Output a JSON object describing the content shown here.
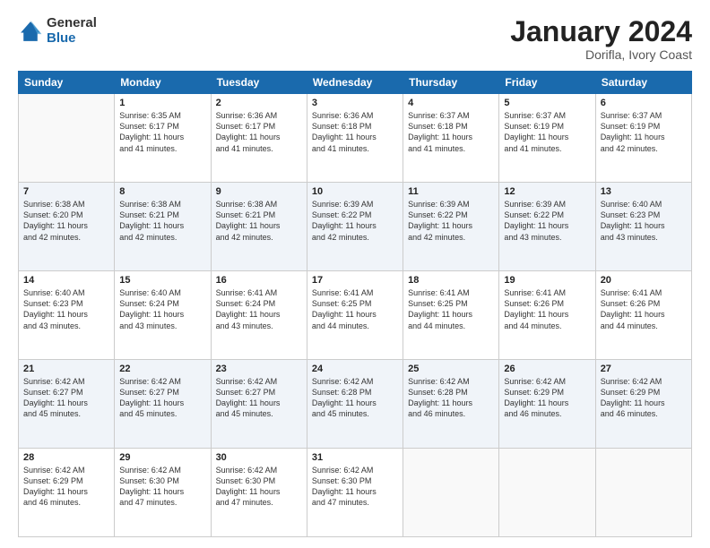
{
  "header": {
    "logo_general": "General",
    "logo_blue": "Blue",
    "main_title": "January 2024",
    "subtitle": "Dorifla, Ivory Coast"
  },
  "days_of_week": [
    "Sunday",
    "Monday",
    "Tuesday",
    "Wednesday",
    "Thursday",
    "Friday",
    "Saturday"
  ],
  "weeks": [
    [
      {
        "day": "",
        "info": ""
      },
      {
        "day": "1",
        "info": "Sunrise: 6:35 AM\nSunset: 6:17 PM\nDaylight: 11 hours\nand 41 minutes."
      },
      {
        "day": "2",
        "info": "Sunrise: 6:36 AM\nSunset: 6:17 PM\nDaylight: 11 hours\nand 41 minutes."
      },
      {
        "day": "3",
        "info": "Sunrise: 6:36 AM\nSunset: 6:18 PM\nDaylight: 11 hours\nand 41 minutes."
      },
      {
        "day": "4",
        "info": "Sunrise: 6:37 AM\nSunset: 6:18 PM\nDaylight: 11 hours\nand 41 minutes."
      },
      {
        "day": "5",
        "info": "Sunrise: 6:37 AM\nSunset: 6:19 PM\nDaylight: 11 hours\nand 41 minutes."
      },
      {
        "day": "6",
        "info": "Sunrise: 6:37 AM\nSunset: 6:19 PM\nDaylight: 11 hours\nand 42 minutes."
      }
    ],
    [
      {
        "day": "7",
        "info": "Sunrise: 6:38 AM\nSunset: 6:20 PM\nDaylight: 11 hours\nand 42 minutes."
      },
      {
        "day": "8",
        "info": "Sunrise: 6:38 AM\nSunset: 6:21 PM\nDaylight: 11 hours\nand 42 minutes."
      },
      {
        "day": "9",
        "info": "Sunrise: 6:38 AM\nSunset: 6:21 PM\nDaylight: 11 hours\nand 42 minutes."
      },
      {
        "day": "10",
        "info": "Sunrise: 6:39 AM\nSunset: 6:22 PM\nDaylight: 11 hours\nand 42 minutes."
      },
      {
        "day": "11",
        "info": "Sunrise: 6:39 AM\nSunset: 6:22 PM\nDaylight: 11 hours\nand 42 minutes."
      },
      {
        "day": "12",
        "info": "Sunrise: 6:39 AM\nSunset: 6:22 PM\nDaylight: 11 hours\nand 43 minutes."
      },
      {
        "day": "13",
        "info": "Sunrise: 6:40 AM\nSunset: 6:23 PM\nDaylight: 11 hours\nand 43 minutes."
      }
    ],
    [
      {
        "day": "14",
        "info": "Sunrise: 6:40 AM\nSunset: 6:23 PM\nDaylight: 11 hours\nand 43 minutes."
      },
      {
        "day": "15",
        "info": "Sunrise: 6:40 AM\nSunset: 6:24 PM\nDaylight: 11 hours\nand 43 minutes."
      },
      {
        "day": "16",
        "info": "Sunrise: 6:41 AM\nSunset: 6:24 PM\nDaylight: 11 hours\nand 43 minutes."
      },
      {
        "day": "17",
        "info": "Sunrise: 6:41 AM\nSunset: 6:25 PM\nDaylight: 11 hours\nand 44 minutes."
      },
      {
        "day": "18",
        "info": "Sunrise: 6:41 AM\nSunset: 6:25 PM\nDaylight: 11 hours\nand 44 minutes."
      },
      {
        "day": "19",
        "info": "Sunrise: 6:41 AM\nSunset: 6:26 PM\nDaylight: 11 hours\nand 44 minutes."
      },
      {
        "day": "20",
        "info": "Sunrise: 6:41 AM\nSunset: 6:26 PM\nDaylight: 11 hours\nand 44 minutes."
      }
    ],
    [
      {
        "day": "21",
        "info": "Sunrise: 6:42 AM\nSunset: 6:27 PM\nDaylight: 11 hours\nand 45 minutes."
      },
      {
        "day": "22",
        "info": "Sunrise: 6:42 AM\nSunset: 6:27 PM\nDaylight: 11 hours\nand 45 minutes."
      },
      {
        "day": "23",
        "info": "Sunrise: 6:42 AM\nSunset: 6:27 PM\nDaylight: 11 hours\nand 45 minutes."
      },
      {
        "day": "24",
        "info": "Sunrise: 6:42 AM\nSunset: 6:28 PM\nDaylight: 11 hours\nand 45 minutes."
      },
      {
        "day": "25",
        "info": "Sunrise: 6:42 AM\nSunset: 6:28 PM\nDaylight: 11 hours\nand 46 minutes."
      },
      {
        "day": "26",
        "info": "Sunrise: 6:42 AM\nSunset: 6:29 PM\nDaylight: 11 hours\nand 46 minutes."
      },
      {
        "day": "27",
        "info": "Sunrise: 6:42 AM\nSunset: 6:29 PM\nDaylight: 11 hours\nand 46 minutes."
      }
    ],
    [
      {
        "day": "28",
        "info": "Sunrise: 6:42 AM\nSunset: 6:29 PM\nDaylight: 11 hours\nand 46 minutes."
      },
      {
        "day": "29",
        "info": "Sunrise: 6:42 AM\nSunset: 6:30 PM\nDaylight: 11 hours\nand 47 minutes."
      },
      {
        "day": "30",
        "info": "Sunrise: 6:42 AM\nSunset: 6:30 PM\nDaylight: 11 hours\nand 47 minutes."
      },
      {
        "day": "31",
        "info": "Sunrise: 6:42 AM\nSunset: 6:30 PM\nDaylight: 11 hours\nand 47 minutes."
      },
      {
        "day": "",
        "info": ""
      },
      {
        "day": "",
        "info": ""
      },
      {
        "day": "",
        "info": ""
      }
    ]
  ]
}
